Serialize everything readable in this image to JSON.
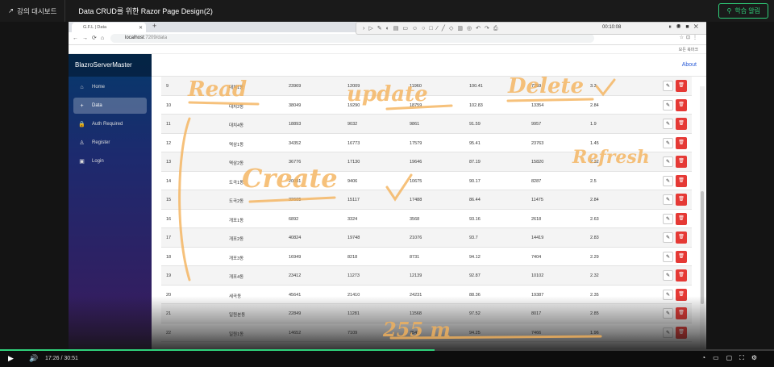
{
  "player": {
    "dashboard_label": "강의 대시보드",
    "lecture_title": "Data CRUD를 위한 Razor Page Design(2)",
    "ask_label": "학습 알림",
    "time_current": "17:26",
    "time_total": "30:51",
    "progress": 0.561,
    "accent": "#2fd07a"
  },
  "browser": {
    "tab_title": "G.F.L | Data",
    "url_host": "localhost",
    "url_path": ":7209/data",
    "bookmark": "모든 북마크"
  },
  "recorder": {
    "time": "00:10:08"
  },
  "app": {
    "brand": "BlazroServerMaster",
    "about": "About",
    "nav": [
      {
        "label": "Home",
        "icon": "home-icon"
      },
      {
        "label": "Data",
        "icon": "plus-icon",
        "active": true
      },
      {
        "label": "Auth Required",
        "icon": "lock-icon"
      },
      {
        "label": "Register",
        "icon": "person-icon"
      },
      {
        "label": "Login",
        "icon": "login-icon"
      }
    ],
    "rows": [
      [
        "9",
        "대치1동",
        "23969",
        "12009",
        "11960",
        "100.41",
        "7259",
        "3.3"
      ],
      [
        "10",
        "대치2동",
        "38049",
        "19290",
        "18759",
        "102.83",
        "13354",
        "2.84"
      ],
      [
        "11",
        "대치4동",
        "18893",
        "9032",
        "9861",
        "91.59",
        "9957",
        "1.9"
      ],
      [
        "12",
        "역삼1동",
        "34352",
        "16773",
        "17579",
        "95.41",
        "23763",
        "1.45"
      ],
      [
        "13",
        "역삼2동",
        "36776",
        "17130",
        "19646",
        "87.19",
        "15820",
        "2.32"
      ],
      [
        "14",
        "도곡1동",
        "20081",
        "9406",
        "10675",
        "90.17",
        "8287",
        "2.5"
      ],
      [
        "15",
        "도곡2동",
        "32605",
        "15117",
        "17488",
        "86.44",
        "11475",
        "2.84"
      ],
      [
        "16",
        "개포1동",
        "6892",
        "3324",
        "3568",
        "93.16",
        "2618",
        "2.63"
      ],
      [
        "17",
        "개포2동",
        "40824",
        "19748",
        "21076",
        "93.7",
        "14419",
        "2.83"
      ],
      [
        "18",
        "개포3동",
        "16949",
        "8218",
        "8731",
        "94.12",
        "7404",
        "2.29"
      ],
      [
        "19",
        "개포4동",
        "23412",
        "11273",
        "12139",
        "92.87",
        "10102",
        "2.32"
      ],
      [
        "20",
        "세곡동",
        "45641",
        "21410",
        "24231",
        "88.36",
        "19387",
        "2.35"
      ],
      [
        "21",
        "일원본동",
        "22849",
        "11281",
        "11568",
        "97.52",
        "8017",
        "2.85"
      ],
      [
        "22",
        "일원1동",
        "14652",
        "7109",
        "7543",
        "94.25",
        "7466",
        "1.96"
      ]
    ]
  },
  "annotations": [
    "Read",
    "update",
    "Delete",
    "Refresh",
    "Create",
    "255 m"
  ]
}
